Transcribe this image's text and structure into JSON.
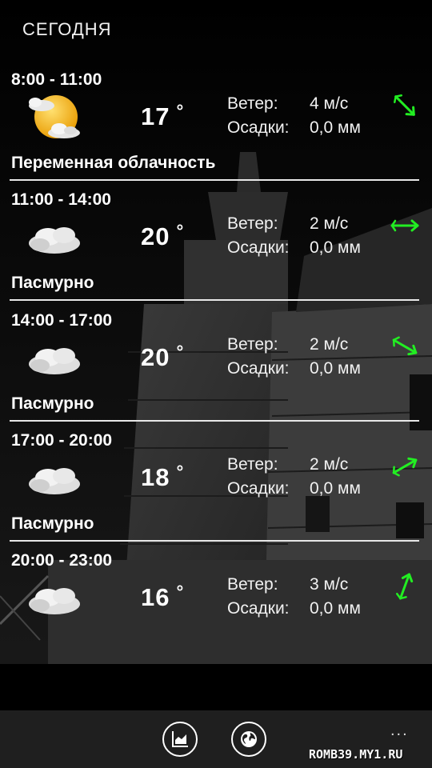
{
  "header": {
    "title": "СЕГОДНЯ"
  },
  "forecast": [
    {
      "time": "8:00 - 11:00",
      "temp": "17",
      "deg": "°",
      "wind_label": "Ветер:",
      "wind": "4 м/с",
      "precip_label": "Осадки:",
      "precip": "0,0 мм",
      "condition": "Переменная облачность",
      "icon": "partly-cloudy-icon",
      "wind_direction_deg": 45
    },
    {
      "time": "11:00 - 14:00",
      "temp": "20",
      "deg": "°",
      "wind_label": "Ветер:",
      "wind": "2 м/с",
      "precip_label": "Осадки:",
      "precip": "0,0 мм",
      "condition": "Пасмурно",
      "icon": "cloud-icon",
      "wind_direction_deg": 90
    },
    {
      "time": "14:00 - 17:00",
      "temp": "20",
      "deg": "°",
      "wind_label": "Ветер:",
      "wind": "2 м/с",
      "precip_label": "Осадки:",
      "precip": "0,0 мм",
      "condition": "Пасмурно",
      "icon": "cloud-icon",
      "wind_direction_deg": 60
    },
    {
      "time": "17:00 - 20:00",
      "temp": "18",
      "deg": "°",
      "wind_label": "Ветер:",
      "wind": "2 м/с",
      "precip_label": "Осадки:",
      "precip": "0,0 мм",
      "condition": "Пасмурно",
      "icon": "cloud-icon",
      "wind_direction_deg": 120
    },
    {
      "time": "20:00 - 23:00",
      "temp": "16",
      "deg": "°",
      "wind_label": "Ветер:",
      "wind": "3 м/с",
      "precip_label": "Осадки:",
      "precip": "0,0 мм",
      "condition": "",
      "icon": "cloud-icon",
      "wind_direction_deg": 160
    }
  ],
  "appbar": {
    "more": "..."
  },
  "watermark": "ROMB39.MY1.RU",
  "colors": {
    "wind_arrow": "#22ee22",
    "background": "#000000",
    "appbar": "#1f1f1f",
    "sun": "#f5b400"
  }
}
